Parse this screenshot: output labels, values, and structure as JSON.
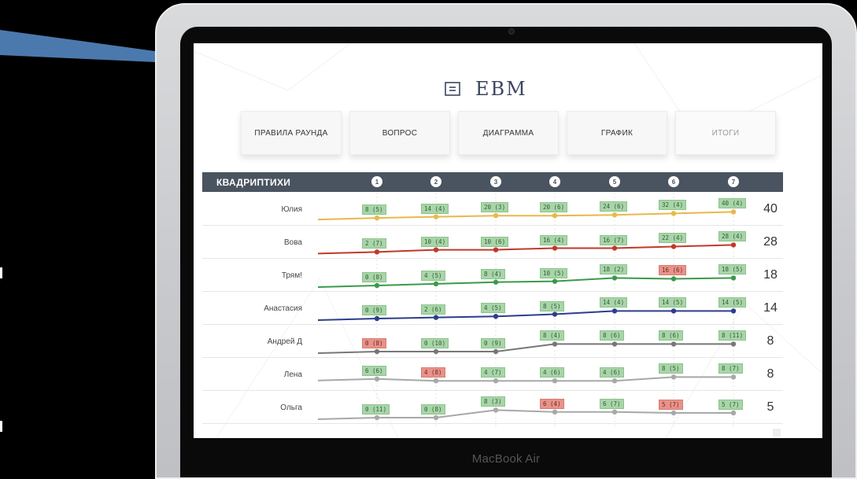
{
  "device": {
    "brand_label": "MacBook Air"
  },
  "app": {
    "logo_text": "EBM",
    "nav": [
      {
        "label": "ПРАВИЛА РАУНДА",
        "active": true
      },
      {
        "label": "ВОПРОС",
        "active": true
      },
      {
        "label": "ДИАГРАММА",
        "active": true
      },
      {
        "label": "ГРАФИК",
        "active": true
      },
      {
        "label": "ИТОГИ",
        "active": false
      }
    ],
    "table": {
      "title": "КВАДРИПТИХИ",
      "rounds": [
        "1",
        "2",
        "3",
        "4",
        "5",
        "6",
        "7"
      ]
    }
  },
  "chart_data": {
    "type": "line",
    "x": [
      1,
      2,
      3,
      4,
      5,
      6,
      7
    ],
    "series": [
      {
        "name": "Юлия",
        "total": "40",
        "color": "#e8b84a",
        "values": [
          8,
          14,
          20,
          20,
          24,
          32,
          40
        ],
        "labels": [
          "8 (5)",
          "14 (4)",
          "20 (3)",
          "20 (6)",
          "24 (6)",
          "32 (4)",
          "40 (4)"
        ],
        "bad": [
          false,
          false,
          false,
          false,
          false,
          false,
          false
        ]
      },
      {
        "name": "Вова",
        "total": "28",
        "color": "#c0392b",
        "values": [
          2,
          10,
          10,
          16,
          16,
          22,
          28
        ],
        "labels": [
          "2 (7)",
          "10 (4)",
          "10 (6)",
          "16 (4)",
          "16 (7)",
          "22 (4)",
          "28 (4)"
        ],
        "bad": [
          false,
          false,
          false,
          false,
          false,
          false,
          false
        ]
      },
      {
        "name": "Трям!",
        "total": "18",
        "color": "#3a9a4a",
        "values": [
          0,
          4,
          8,
          10,
          18,
          16,
          18
        ],
        "labels": [
          "0 (8)",
          "4 (5)",
          "8 (4)",
          "10 (5)",
          "18 (2)",
          "16 (6)",
          "18 (5)"
        ],
        "bad": [
          false,
          false,
          false,
          false,
          false,
          true,
          false
        ]
      },
      {
        "name": "Анастасия",
        "total": "14",
        "color": "#2c3e8a",
        "values": [
          0,
          2,
          4,
          8,
          14,
          14,
          14
        ],
        "labels": [
          "0 (9)",
          "2 (6)",
          "4 (5)",
          "8 (5)",
          "14 (4)",
          "14 (5)",
          "14 (5)"
        ],
        "bad": [
          false,
          false,
          false,
          false,
          false,
          false,
          false
        ]
      },
      {
        "name": "Андрей Д",
        "total": "8",
        "color": "#777777",
        "values": [
          0,
          0,
          0,
          8,
          8,
          8,
          8
        ],
        "labels": [
          "0 (8)",
          "0 (10)",
          "0 (9)",
          "8 (4)",
          "8 (6)",
          "8 (6)",
          "8 (11)"
        ],
        "bad": [
          true,
          false,
          false,
          false,
          false,
          false,
          false
        ]
      },
      {
        "name": "Лена",
        "total": "8",
        "color": "#a8a8a8",
        "values": [
          6,
          4,
          4,
          4,
          4,
          8,
          8
        ],
        "labels": [
          "6 (6)",
          "4 (8)",
          "4 (7)",
          "4 (6)",
          "4 (6)",
          "8 (5)",
          "8 (7)"
        ],
        "bad": [
          false,
          true,
          false,
          false,
          false,
          false,
          false
        ]
      },
      {
        "name": "Ольга",
        "total": "5",
        "color": "#a8a8a8",
        "values": [
          0,
          0,
          8,
          6,
          6,
          5,
          5
        ],
        "labels": [
          "0 (11)",
          "0 (8)",
          "8 (3)",
          "6 (4)",
          "6 (7)",
          "5 (7)",
          "5 (7)"
        ],
        "bad": [
          false,
          false,
          false,
          true,
          false,
          true,
          false
        ]
      }
    ]
  }
}
